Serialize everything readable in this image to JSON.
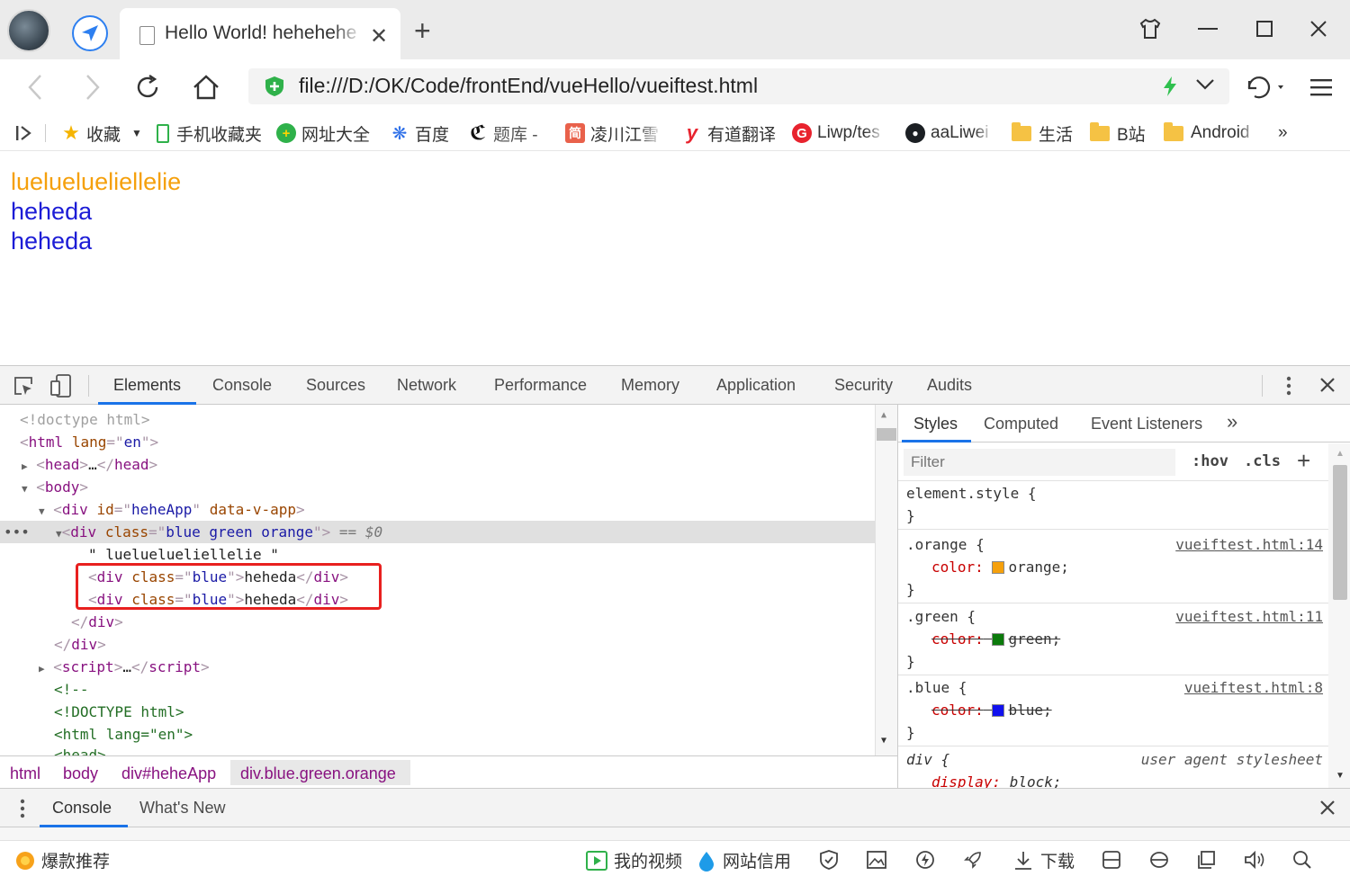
{
  "browser": {
    "tab_title": "Hello World! hehehehe",
    "url": "file:///D:/OK/Code/frontEnd/vueHello/vueiftest.html"
  },
  "bookmarks": [
    {
      "label": "收藏"
    },
    {
      "label": "手机收藏夹"
    },
    {
      "label": "网址大全"
    },
    {
      "label": "百度"
    },
    {
      "label": "题库 -"
    },
    {
      "label": "凌川江雪"
    },
    {
      "label": "有道翻译"
    },
    {
      "label": "Liwp/tes"
    },
    {
      "label": "aaLiwei"
    },
    {
      "label": "生活"
    },
    {
      "label": "B站"
    },
    {
      "label": "Android"
    }
  ],
  "bookmark_more": "»",
  "page": {
    "lines": [
      {
        "text": "lueluelueliellelie",
        "color": "#f5a00c"
      },
      {
        "text": "heheda",
        "color": "#1c1cd6"
      },
      {
        "text": "heheda",
        "color": "#1c1cd6"
      }
    ]
  },
  "devtools": {
    "tabs": [
      "Elements",
      "Console",
      "Sources",
      "Network",
      "Performance",
      "Memory",
      "Application",
      "Security",
      "Audits"
    ],
    "active_tab": "Elements",
    "dom": {
      "doctype": "<!doctype html>",
      "html_open": "html",
      "lang_attr": "lang",
      "lang_val": "en",
      "head_collapsed": "head",
      "body": "body",
      "div": "div",
      "id_attr": "id",
      "id_val": "heheApp",
      "data_v_app": "data-v-app",
      "class_attr": "class",
      "class_val": "blue green orange",
      "selected_marker": "== $0",
      "text_node": "\" lueluelueliellelie \"",
      "child_class": "blue",
      "child_text": "heheda",
      "script": "script",
      "comment_open": "<!--",
      "comment_doctype": "<!DOCTYPE html>",
      "comment_html": "<html lang=\"en\">",
      "comment_head": "<head>",
      "ellipsis": "…"
    },
    "breadcrumbs": [
      "html",
      "body",
      "div#heheApp",
      "div.blue.green.orange"
    ],
    "styles_tabs": [
      "Styles",
      "Computed",
      "Event Listeners"
    ],
    "styles_more": "»",
    "filter_placeholder": "Filter",
    "hov": ":hov",
    "cls": ".cls",
    "rules": {
      "element_style": "element.style {",
      "close": "}",
      "orange": {
        "selector": ".orange {",
        "source": "vueiftest.html:14",
        "prop": "color:",
        "value": "orange;",
        "swatch": "#f5a00c"
      },
      "green": {
        "selector": ".green {",
        "source": "vueiftest.html:11",
        "prop": "color:",
        "value": "green;",
        "swatch": "#0b7a0b"
      },
      "blue": {
        "selector": ".blue {",
        "source": "vueiftest.html:8",
        "prop": "color:",
        "value": "blue;",
        "swatch": "#1111ee"
      },
      "div": {
        "selector": "div {",
        "source": "user agent stylesheet",
        "prop": "display:",
        "value": "block;"
      }
    },
    "drawer_tabs": [
      "Console",
      "What's New"
    ]
  },
  "statusbar": {
    "left": "爆款推荐",
    "video": "我的视频",
    "credit": "网站信用",
    "download": "下载"
  }
}
